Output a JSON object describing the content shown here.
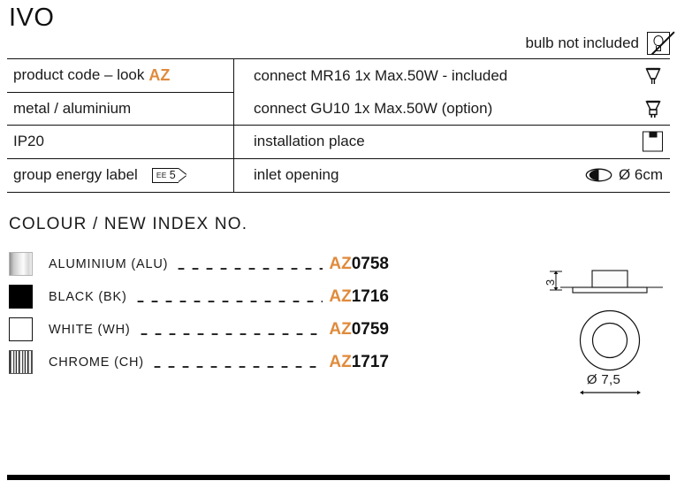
{
  "product": {
    "title": "IVO",
    "bulb_note": "bulb not included",
    "bulb_note_icon": "no-bulb-icon"
  },
  "colors": {
    "accent_orange": "#e08b3c",
    "text_black": "#1a1a1a",
    "rule_black": "#111111"
  },
  "spec_table": {
    "left_column": [
      {
        "label": "product code – look",
        "highlight": "AZ"
      },
      {
        "label": "metal / aluminium",
        "highlight": ""
      },
      {
        "label": "IP20",
        "highlight": ""
      },
      {
        "label": "group energy label",
        "highlight": "",
        "badge": {
          "prefix": "EE",
          "value": "5"
        }
      }
    ],
    "right_column": [
      {
        "text": "connect MR16 1x Max.50W - included",
        "icon": "mr16-lamp-icon"
      },
      {
        "text": "connect GU10 1x Max.50W (option)",
        "icon": "gu10-lamp-icon"
      },
      {
        "text": "installation place",
        "icon": "recessed-ceiling-icon"
      },
      {
        "text": "inlet opening",
        "icon": "inlet-opening-icon",
        "value": "Ø 6cm"
      }
    ]
  },
  "colour_section": {
    "heading": "COLOUR / NEW INDEX NO.",
    "rows": [
      {
        "swatch": "aluminium-swatch",
        "name": "ALUMINIUM (ALU)",
        "prefix": "AZ",
        "number": "0758"
      },
      {
        "swatch": "black-swatch",
        "name": "BLACK (BK)",
        "prefix": "AZ",
        "number": "1716"
      },
      {
        "swatch": "white-swatch",
        "name": "WHITE (WH)",
        "prefix": "AZ",
        "number": "0759"
      },
      {
        "swatch": "chrome-swatch",
        "name": "CHROME (CH)",
        "prefix": "AZ",
        "number": "1717"
      }
    ]
  },
  "technical_drawing": {
    "height_label": "3",
    "diameter_label": "Ø 7,5"
  }
}
